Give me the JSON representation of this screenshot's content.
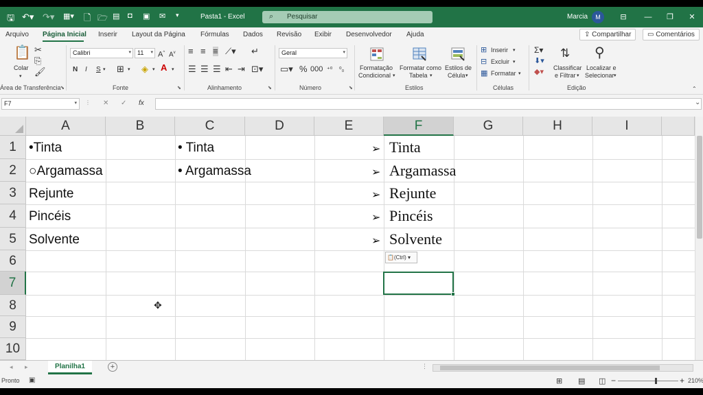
{
  "titlebar": {
    "title": "Pasta1  -  Excel",
    "search_placeholder": "Pesquisar",
    "user": "Marcia",
    "avatar": "M"
  },
  "menu": {
    "tabs": [
      "Arquivo",
      "Página Inicial",
      "Inserir",
      "Layout da Página",
      "Fórmulas",
      "Dados",
      "Revisão",
      "Exibir",
      "Desenvolvedor",
      "Ajuda"
    ],
    "share": "Compartilhar",
    "comments": "Comentários"
  },
  "ribbon": {
    "paste": "Colar",
    "font_name": "Calibri",
    "font_size": "11",
    "bold": "N",
    "italic": "I",
    "underline": "S",
    "number_format": "Geral",
    "conditional_format": "Formatação",
    "conditional_format2": "Condicional",
    "format_table": "Formatar como",
    "format_table2": "Tabela",
    "cell_styles": "Estilos de",
    "cell_styles2": "Célula",
    "insert": "Inserir",
    "delete": "Excluir",
    "format": "Formatar",
    "sort_filter": "Classificar",
    "sort_filter2": "e Filtrar",
    "find_select": "Localizar e",
    "find_select2": "Selecionar",
    "groups": {
      "clipboard": "Área de Transferência",
      "font": "Fonte",
      "alignment": "Alinhamento",
      "number": "Número",
      "styles": "Estilos",
      "cells": "Células",
      "editing": "Edição"
    }
  },
  "formula_bar": {
    "name_box": "F7",
    "cancel": "✕",
    "enter": "✓",
    "fx": "fx",
    "content": ""
  },
  "grid": {
    "columns": [
      "A",
      "B",
      "C",
      "D",
      "E",
      "F",
      "G",
      "H",
      "I"
    ],
    "rows": [
      "1",
      "2",
      "3",
      "4",
      "5",
      "6",
      "7",
      "8",
      "9",
      "10"
    ],
    "col_a": [
      "•Tinta",
      "○Argamassa",
      "Rejunte",
      "Pincéis",
      "Solvente"
    ],
    "col_c": [
      "• Tinta",
      "• Argamassa"
    ],
    "col_f_arrow": "➢",
    "col_f": [
      "Tinta",
      "Argamassa",
      "Rejunte",
      "Pincéis",
      "Solvente"
    ],
    "paste_options": "(Ctrl) ▾"
  },
  "sheets": {
    "active": "Planilha1"
  },
  "status": {
    "ready": "Pronto",
    "zoom": "210%"
  },
  "colors": {
    "accent": "#217346",
    "user_avatar": "#2b579a"
  }
}
